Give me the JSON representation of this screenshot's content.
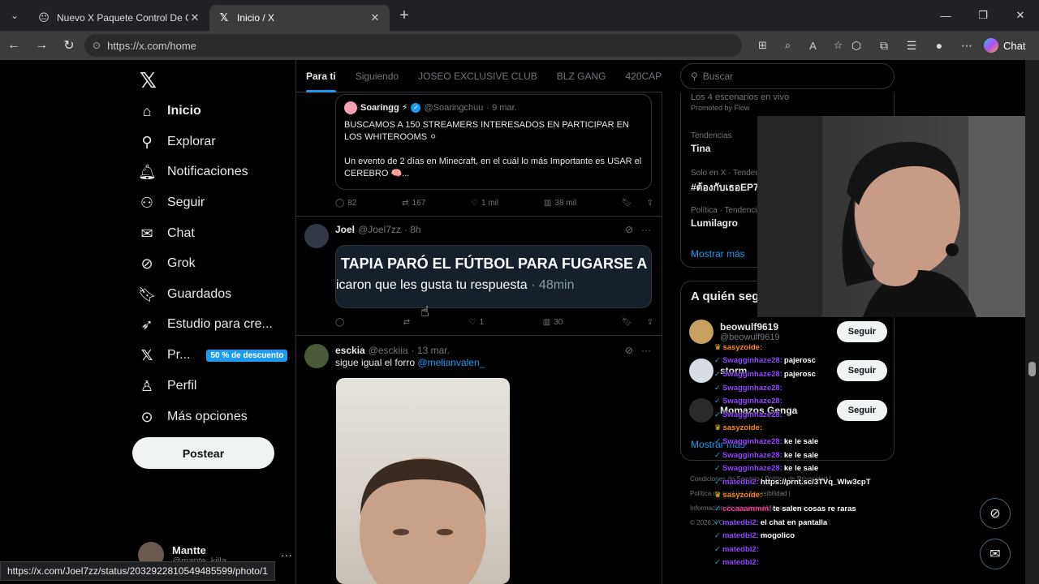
{
  "browser": {
    "tabs": [
      {
        "title": "Nuevo X Paquete Control De Gesti",
        "icon": "emoji-favicon",
        "active": false
      },
      {
        "title": "Inicio / X",
        "icon": "x-favicon",
        "active": true
      }
    ],
    "url": "https://x.com/home",
    "chat_label": "Chat",
    "status_url": "https://x.com/Joel7zz/status/2032922810549485599/photo/1"
  },
  "sidebar": {
    "items": [
      {
        "label": "Inicio",
        "icon": "home-icon"
      },
      {
        "label": "Explorar",
        "icon": "search-icon"
      },
      {
        "label": "Notificaciones",
        "icon": "bell-icon"
      },
      {
        "label": "Seguir",
        "icon": "add-user-icon"
      },
      {
        "label": "Chat",
        "icon": "mail-icon"
      },
      {
        "label": "Grok",
        "icon": "grok-icon"
      },
      {
        "label": "Guardados",
        "icon": "bookmark-icon"
      },
      {
        "label": "Estudio para cre...",
        "icon": "rocket-icon"
      },
      {
        "label": "Pr...",
        "icon": "x-premium-icon",
        "badge": "50 % de descuento"
      },
      {
        "label": "Perfil",
        "icon": "person-icon"
      },
      {
        "label": "Más opciones",
        "icon": "more-circle-icon"
      }
    ],
    "post_button": "Postear",
    "account": {
      "name": "Mantte",
      "handle": "@mante_killa"
    }
  },
  "timeline": {
    "tabs": [
      "Para ti",
      "Siguiendo",
      "JOSEO EXCLUSIVE CLUB",
      "BLZ GANG",
      "420CAP"
    ],
    "quote": {
      "author": "Soaringg ⚡",
      "handle": "@Soaringchuu",
      "date": "· 9 mar.",
      "text1": "BUSCAMOS A 150 STREAMERS INTERESADOS EN PARTICIPAR EN LOS WHITEROOMS ⚪",
      "text2": "Un evento de 2 días en Minecraft, en el cuál lo más Importante es USAR el CEREBRO 🧠..."
    },
    "post1_actions": {
      "replies": "82",
      "reposts": "167",
      "likes": "1 mil",
      "views": "38 mil"
    },
    "post2": {
      "author": "Joel",
      "handle": "@Joel7zz",
      "time": "· 8h",
      "image_line1": "TAPIA PARÓ EL FÚTBOL PARA FUGARSE A I",
      "image_line2": "icaron que les gusta tu respuesta",
      "image_line2_time": "· 48min",
      "likes": "1",
      "views": "30"
    },
    "post3": {
      "author": "esckia",
      "handle": "@esckiia",
      "date": "· 13 mar.",
      "text": "sigue igual el forro",
      "mention": "@melianvalen_"
    }
  },
  "right": {
    "search_placeholder": "Buscar",
    "promoted": {
      "title": "Los 4 escenarios en vivo",
      "by": "Promoted by Flow"
    },
    "trends": [
      {
        "context": "Tendencias",
        "title": "Tina"
      },
      {
        "context": "Solo en X · Tenden",
        "title": "#ต้องกับเธอEP7"
      },
      {
        "context": "Política · Tendenci",
        "title": "Lumilagro"
      }
    ],
    "show_more": "Mostrar más",
    "follow_title": "A quién seg",
    "follow": [
      {
        "name": "beowulf9619",
        "handle": "@beowulf9619"
      },
      {
        "name": "storm",
        "handle": ""
      },
      {
        "name": "Momazos Genga",
        "handle": ""
      }
    ],
    "follow_label": "Seguir",
    "follow_show_more": "Mostrar más",
    "footer": [
      "Condiciones de Servicio  |  Política de Privacidad  |",
      "Política de cookies  |  Accesibilidad  |",
      "Información de anuncios  |  Más opciones ···",
      "© 2026 X Corp."
    ]
  },
  "stream_chat": [
    {
      "user": "sasyzoide:",
      "msg": "",
      "color": "orange"
    },
    {
      "user": "Swagginhaze28:",
      "msg": "pajerosc",
      "color": "purple"
    },
    {
      "user": "Swagginhaze28:",
      "msg": "pajerosc",
      "color": "purple"
    },
    {
      "user": "Swagginhaze28:",
      "msg": "",
      "color": "purple"
    },
    {
      "user": "Swagginhaze28:",
      "msg": "",
      "color": "purple"
    },
    {
      "user": "Swagginhaze28:",
      "msg": "",
      "color": "purple"
    },
    {
      "user": "sasyzoide:",
      "msg": "",
      "color": "orange"
    },
    {
      "user": "Swagginhaze28:",
      "msg": "ke le sale",
      "color": "purple"
    },
    {
      "user": "Swagginhaze28:",
      "msg": "ke le sale",
      "color": "purple"
    },
    {
      "user": "Swagginhaze28:",
      "msg": "ke le sale",
      "color": "purple"
    },
    {
      "user": "matedbi2:",
      "msg": "https://prnt.sc/3TVq_Wlw3cpT",
      "color": "purple"
    },
    {
      "user": "sasyzoide:",
      "msg": "",
      "color": "orange"
    },
    {
      "user": "cccaaammm:",
      "msg": "te salen cosas re raras",
      "color": "pink"
    },
    {
      "user": "matedbi2:",
      "msg": "el chat en pantalla",
      "color": "purple"
    },
    {
      "user": "matedbi2:",
      "msg": "mogolico",
      "color": "purple"
    },
    {
      "user": "matedbi2:",
      "msg": "",
      "color": "purple"
    },
    {
      "user": "matedbi2:",
      "msg": "",
      "color": "purple"
    }
  ]
}
